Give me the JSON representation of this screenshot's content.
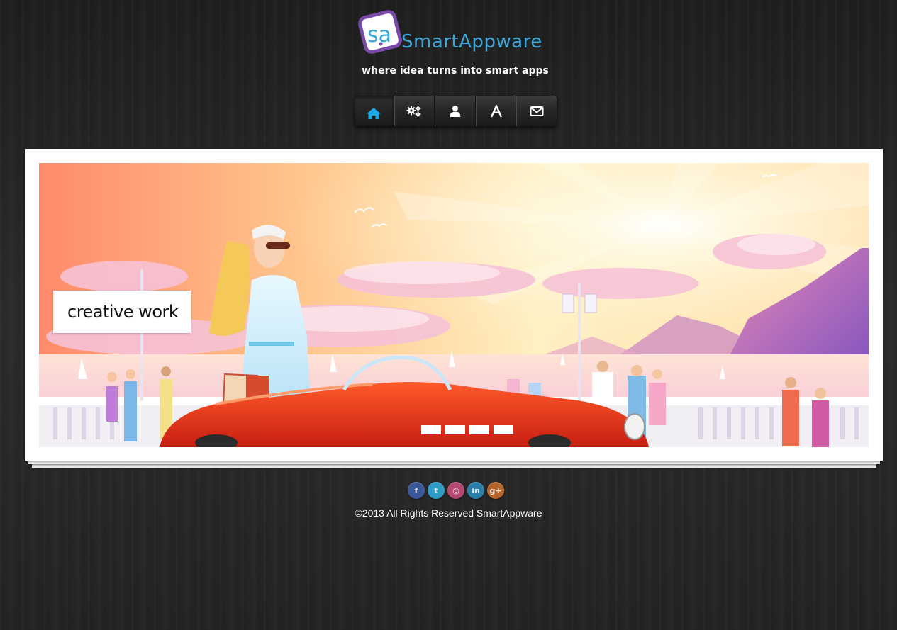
{
  "header": {
    "logo_mark_text": "sa",
    "brand_name": "SmartAppware",
    "tagline": "where idea turns into smart apps"
  },
  "nav": {
    "items": [
      {
        "icon": "home-icon",
        "active": true
      },
      {
        "icon": "gears-icon",
        "active": false
      },
      {
        "icon": "user-icon",
        "active": false
      },
      {
        "icon": "letter-a-icon",
        "active": false
      },
      {
        "icon": "envelope-icon",
        "active": false
      }
    ]
  },
  "slider": {
    "caption": "creative work",
    "slide_count": 4,
    "current_slide": 1
  },
  "footer": {
    "social": [
      {
        "name": "facebook",
        "glyph": "f",
        "color": "#3b5998"
      },
      {
        "name": "twitter",
        "glyph": "t",
        "color": "#2f9bc6"
      },
      {
        "name": "dribbble",
        "glyph": "◎",
        "color": "#b44a72"
      },
      {
        "name": "linkedin",
        "glyph": "in",
        "color": "#2b7fa8"
      },
      {
        "name": "google-plus",
        "glyph": "g+",
        "color": "#b5642a"
      }
    ],
    "copyright": "©2013 All Rights Reserved SmartAppware"
  },
  "colors": {
    "brand": "#3aa7d8",
    "active_nav_icon": "#1ea8e6",
    "nav_icon": "#ffffff"
  }
}
